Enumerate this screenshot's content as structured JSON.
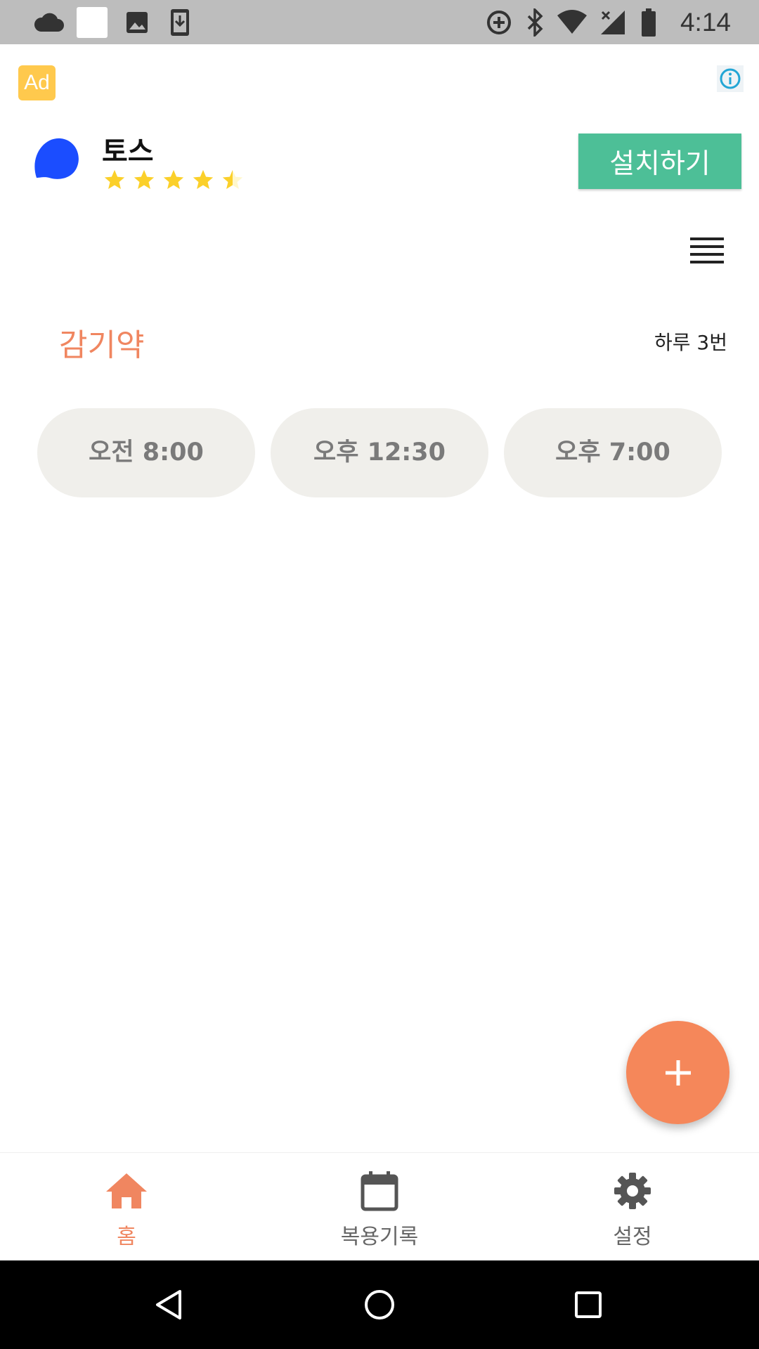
{
  "status_bar": {
    "time": "4:14",
    "left_icons": [
      "cloud-icon",
      "blank-notification-icon",
      "image-icon",
      "download-icon"
    ],
    "right_icons": [
      "data-saver-icon",
      "bluetooth-icon",
      "wifi-icon",
      "no-signal-icon",
      "battery-icon"
    ]
  },
  "ad": {
    "badge": "Ad",
    "app_name": "토스",
    "rating_stars": 4.5,
    "install_label": "설치하기",
    "colors": {
      "badge": "#ffc94d",
      "install": "#4dbf97",
      "logo": "#1b4dff"
    }
  },
  "medicine": {
    "name": "감기약",
    "frequency": "하루 3번",
    "times": [
      "오전 8:00",
      "오후 12:30",
      "오후 7:00"
    ]
  },
  "fab": {
    "icon": "plus-icon",
    "color": "#f5875a"
  },
  "bottom_nav": {
    "items": [
      {
        "label": "홈",
        "icon": "home-icon",
        "active": true
      },
      {
        "label": "복용기록",
        "icon": "calendar-icon",
        "active": false
      },
      {
        "label": "설정",
        "icon": "gear-icon",
        "active": false
      }
    ],
    "active_color": "#f08660"
  },
  "system_nav": [
    "back-icon",
    "home-circle-icon",
    "recents-icon"
  ]
}
